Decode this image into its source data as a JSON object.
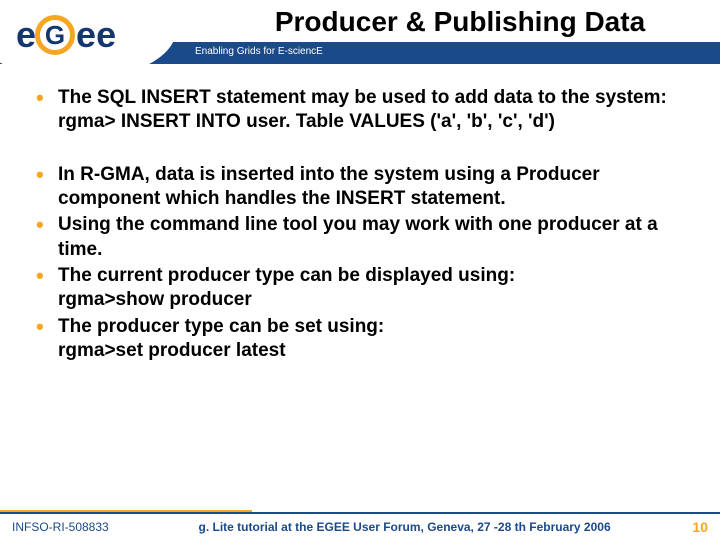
{
  "header": {
    "title": "Producer & Publishing Data",
    "subtitle": "Enabling Grids for E-sciencE",
    "logo_text": "eGee"
  },
  "bullets_group1": [
    {
      "text": "The SQL INSERT statement may be used to add data to the system:",
      "sub": "rgma> INSERT INTO user. Table VALUES ('a', 'b', 'c', 'd')"
    }
  ],
  "bullets_group2": [
    {
      "text": "In R-GMA, data is inserted into the system using a Producer component which handles the INSERT statement."
    },
    {
      "text": "Using the command line tool you may work with one producer at a time."
    },
    {
      "text": "The current producer type can be displayed using:",
      "sub": "rgma>show producer"
    },
    {
      "text": "The producer type can be set using:",
      "sub": "rgma>set producer latest"
    }
  ],
  "footer": {
    "left": "INFSO-RI-508833",
    "center": "g. Lite tutorial at the EGEE User Forum, Geneva, 27 -28 th February 2006",
    "page": "10"
  }
}
